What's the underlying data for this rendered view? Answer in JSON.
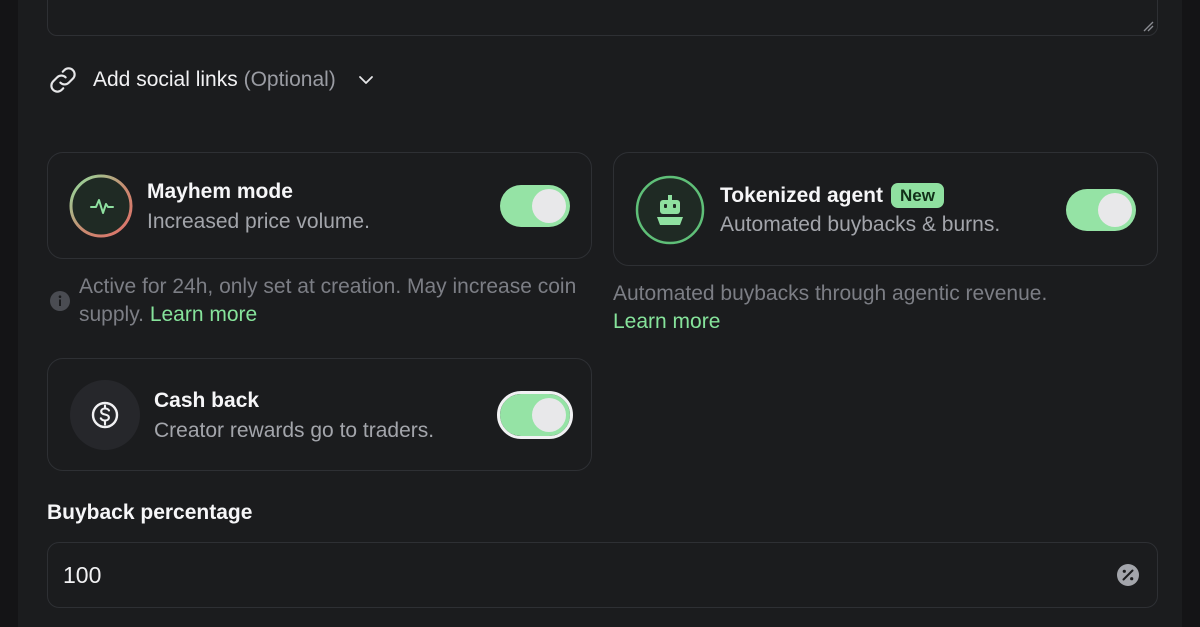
{
  "social": {
    "label": "Add social links",
    "optional": "(Optional)"
  },
  "mayhem": {
    "title": "Mayhem mode",
    "subtitle": "Increased price volume.",
    "enabled": true,
    "help_text": "Active for 24h, only set at creation. May increase coin supply.",
    "help_link": "Learn more"
  },
  "agent": {
    "title": "Tokenized agent",
    "badge": "New",
    "subtitle": "Automated buybacks & burns.",
    "enabled": true,
    "help_text": "Automated buybacks through agentic revenue.",
    "help_link": "Learn more"
  },
  "cashback": {
    "title": "Cash back",
    "subtitle": "Creator rewards go to traders.",
    "enabled": true
  },
  "buyback": {
    "label": "Buyback percentage",
    "value": "100"
  },
  "colors": {
    "accent_green": "#95e3a5",
    "link_green": "#86e39b",
    "background": "#1b1c1e"
  },
  "icons": {
    "social": "link-icon",
    "mayhem": "activity-pulse-icon",
    "agent": "robot-icon",
    "cashback": "dollar-circle-icon",
    "info": "info-icon",
    "percent": "percent-icon"
  }
}
